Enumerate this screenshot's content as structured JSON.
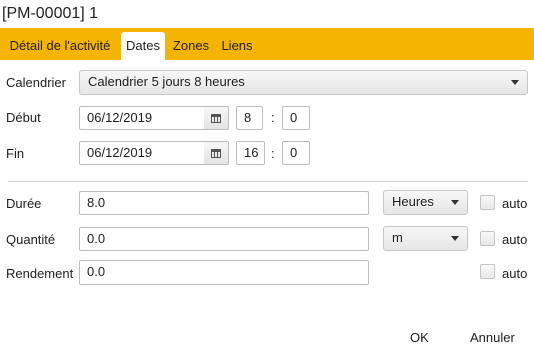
{
  "window": {
    "title": "[PM-00001]  1"
  },
  "tabs": [
    {
      "label": "Détail de l'activité",
      "active": false
    },
    {
      "label": "Dates",
      "active": true
    },
    {
      "label": "Zones",
      "active": false
    },
    {
      "label": "Liens",
      "active": false
    }
  ],
  "form": {
    "calendrier": {
      "label": "Calendrier",
      "value": "Calendrier 5 jours 8 heures"
    },
    "debut": {
      "label": "Début",
      "date": "06/12/2019",
      "hour": "8",
      "minute": "0",
      "separator": ":"
    },
    "fin": {
      "label": "Fin",
      "date": "06/12/2019",
      "hour": "16",
      "minute": "0",
      "separator": ":"
    },
    "duree": {
      "label": "Durée",
      "value": "8.0",
      "unit": "Heures",
      "auto_label": "auto",
      "auto_checked": false
    },
    "quantite": {
      "label": "Quantité",
      "value": "0.0",
      "unit": "m",
      "auto_label": "auto",
      "auto_checked": false
    },
    "rendement": {
      "label": "Rendement",
      "value": "0.0",
      "auto_label": "auto",
      "auto_checked": false
    }
  },
  "footer": {
    "ok_label": "OK",
    "cancel_label": "Annuler"
  },
  "colors": {
    "tab_bar": "#f4b400",
    "background": "#ffffff"
  },
  "icons": {
    "date_picker": "calendar-icon",
    "dropdown": "chevron-down-icon"
  }
}
